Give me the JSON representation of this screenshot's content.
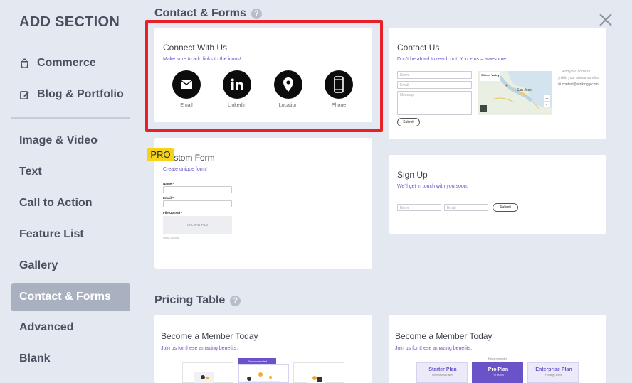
{
  "sidebar": {
    "title": "ADD SECTION",
    "primary": [
      {
        "label": "Commerce",
        "icon": "shopping-bag-icon"
      },
      {
        "label": "Blog & Portfolio",
        "icon": "edit-icon"
      }
    ],
    "items": [
      "Image & Video",
      "Text",
      "Call to Action",
      "Feature List",
      "Gallery",
      "Contact & Forms",
      "Advanced",
      "Blank"
    ],
    "active": "Contact & Forms"
  },
  "sections": {
    "contact": {
      "heading": "Contact & Forms",
      "connect": {
        "title": "Connect With Us",
        "subtitle": "Make sure to add links to the icons!",
        "icons": [
          {
            "label": "Email",
            "icon": "envelope-icon"
          },
          {
            "label": "Linkedin",
            "icon": "linkedin-icon"
          },
          {
            "label": "Location",
            "icon": "map-pin-icon"
          },
          {
            "label": "Phone",
            "icon": "phone-icon"
          }
        ]
      },
      "contact_us": {
        "title": "Contact Us",
        "subtitle": "Don't be afraid to reach out. You + us = awesome.",
        "name_ph": "Name",
        "email_ph": "Email",
        "message_ph": "Message",
        "submit": "Submit",
        "map_label": "Silicon Valley",
        "map_city": "San Jose",
        "address": "Add your address",
        "phone": "Add your phone number",
        "email": "contact@strikingly.com"
      },
      "custom_form": {
        "badge": "PRO",
        "title": "Custom Form",
        "subtitle": "Create unique form!",
        "name_label": "Name *",
        "email_label": "Email *",
        "file_label": "File Upload *",
        "upload_btn": "UPLOAD FILE",
        "footnote": "Up to 100MB"
      },
      "signup": {
        "title": "Sign Up",
        "subtitle": "We'll get in touch with you soon.",
        "name_ph": "Name",
        "email_ph": "Email",
        "submit": "Submit"
      }
    },
    "pricing": {
      "heading": "Pricing Table",
      "card1": {
        "title": "Become a Member Today",
        "subtitle": "Join us for these amazing benefits.",
        "recommended": "Recommended"
      },
      "card2": {
        "title": "Become a Member Today",
        "subtitle": "Join us for these amazing benefits.",
        "recommended": "Recommended",
        "plans": [
          {
            "name": "Starter Plan",
            "desc": "For individual users"
          },
          {
            "name": "Pro Plan",
            "desc": "For teams"
          },
          {
            "name": "Enterprise Plan",
            "desc": "For large teams"
          }
        ]
      }
    }
  },
  "colors": {
    "accent": "#6a52c9",
    "highlight": "#e8202a",
    "pro_badge": "#f6d21a",
    "sidebar_active": "#a9b1c1",
    "background": "#e4e8f0"
  }
}
